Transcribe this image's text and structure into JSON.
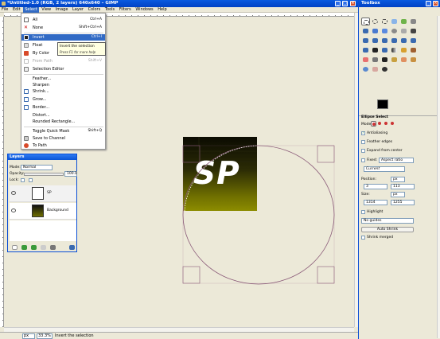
{
  "window": {
    "title": "*Untitled-1.0 (RGB, 2 layers) 640x640 – GIMP"
  },
  "menubar": [
    "File",
    "Edit",
    "Select",
    "View",
    "Image",
    "Layer",
    "Colors",
    "Tools",
    "Filters",
    "Windows",
    "Help"
  ],
  "select_menu": {
    "items": [
      {
        "label": "All",
        "shortcut": "Ctrl+A"
      },
      {
        "label": "None",
        "shortcut": "Shift+Ctrl+A"
      },
      {
        "label": "Invert",
        "shortcut": "Ctrl+I"
      },
      {
        "label": "Float",
        "shortcut": "Shift+Ctrl+L"
      },
      {
        "label": "By Color",
        "shortcut": "Shift+O"
      },
      {
        "label": "From Path",
        "shortcut": "Shift+V"
      },
      {
        "label": "Selection Editor",
        "shortcut": ""
      },
      {
        "label": "Feather...",
        "shortcut": ""
      },
      {
        "label": "Sharpen",
        "shortcut": ""
      },
      {
        "label": "Shrink...",
        "shortcut": ""
      },
      {
        "label": "Grow...",
        "shortcut": ""
      },
      {
        "label": "Border...",
        "shortcut": ""
      },
      {
        "label": "Distort...",
        "shortcut": ""
      },
      {
        "label": "Rounded Rectangle...",
        "shortcut": ""
      },
      {
        "label": "Toggle Quick Mask",
        "shortcut": "Shift+Q"
      },
      {
        "label": "Save to Channel",
        "shortcut": ""
      },
      {
        "label": "To Path",
        "shortcut": ""
      }
    ],
    "tooltip": "Invert the selection",
    "tooltip_hint": "Press F1 for more help"
  },
  "canvas": {
    "image_text": "SP"
  },
  "layers_panel": {
    "title": "Layers",
    "mode_label": "Mode:",
    "mode_value": "Normal",
    "opacity_label": "Opacity:",
    "opacity_value": "100.0",
    "lock_label": "Lock:",
    "layers": [
      "SP",
      "Background"
    ]
  },
  "statusbar": {
    "unit": "px",
    "zoom": "33.3%",
    "message": "Invert the selection"
  },
  "toolbox": {
    "title": "Toolbox",
    "options_title": "Ellipse Select",
    "mode_label": "Mode:",
    "antialiasing": "Antialiasing",
    "feather_edges": "Feather edges",
    "expand_from_center": "Expand from center",
    "fixed_label": "Fixed:",
    "fixed_value": "Aspect ratio",
    "current_value": "Current",
    "position_label": "Position:",
    "position_unit": "px",
    "position_x": "3",
    "position_y": "113",
    "size_label": "Size:",
    "size_unit": "px",
    "size_w": "1314",
    "size_h": "1255",
    "highlight": "Highlight",
    "quality_value": "No guides",
    "auto_shrink": "Auto Shrink",
    "shrink_merged": "Shrink merged"
  },
  "colors": {
    "accent": "#316ac5",
    "titlebar": "#0a5ae0",
    "selection_outline": "#8a5a78"
  }
}
